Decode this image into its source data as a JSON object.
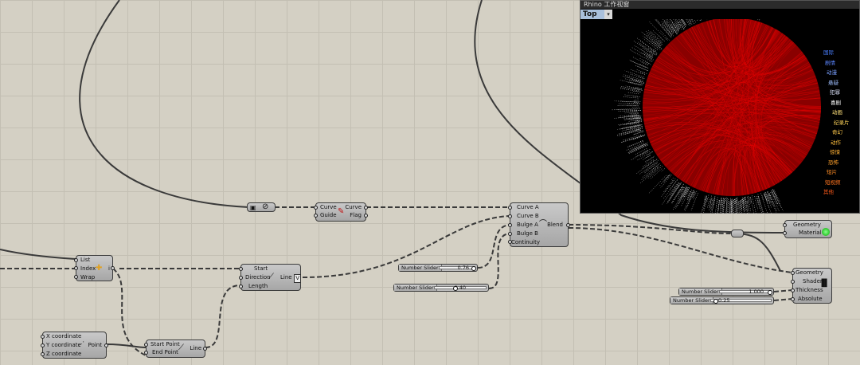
{
  "viewport": {
    "title": "Rhino 工作视窗",
    "view_name": "Top",
    "labels": [
      {
        "text": "国际",
        "color": "#4a7fff"
      },
      {
        "text": "剧情",
        "color": "#5b86ff"
      },
      {
        "text": "动漫",
        "color": "#7aa0ff"
      },
      {
        "text": "悬疑",
        "color": "#a0bfff"
      },
      {
        "text": "犯罪",
        "color": "#dfe6ff"
      },
      {
        "text": "喜剧",
        "color": "#ffffff"
      },
      {
        "text": "动画",
        "color": "#ffe07a"
      },
      {
        "text": "纪录片",
        "color": "#ffd55a"
      },
      {
        "text": "奇幻",
        "color": "#ffc94a"
      },
      {
        "text": "动作",
        "color": "#ffbf3d"
      },
      {
        "text": "惊悚",
        "color": "#ffb033"
      },
      {
        "text": "恐怖",
        "color": "#ffa02b"
      },
      {
        "text": "短片",
        "color": "#ff8c24"
      },
      {
        "text": "短视频",
        "color": "#ff741f"
      },
      {
        "text": "其他",
        "color": "#ff5a1a"
      }
    ]
  },
  "components": {
    "list_item": {
      "inputs": [
        "List",
        "Index",
        "Wrap"
      ],
      "output": "i"
    },
    "curve": {
      "inputs": [
        "Curve",
        "Guide"
      ],
      "outputs": [
        "Curve",
        "Flag"
      ]
    },
    "line_sdl": {
      "inputs": [
        "Start",
        "Direction",
        "Length"
      ],
      "output": "Line",
      "badge": "V"
    },
    "point": {
      "inputs": [
        "X coordinate",
        "Y coordinate",
        "Z coordinate"
      ],
      "output": "Point"
    },
    "line_two": {
      "inputs": [
        "Start Point",
        "End Point"
      ],
      "output": "Line"
    },
    "blend": {
      "inputs": [
        "Curve A",
        "Curve B",
        "Bulge A",
        "Bulge B",
        "Continuity"
      ],
      "output": "Blend"
    },
    "preview": {
      "inputs": [
        "Geometry",
        "Material"
      ]
    },
    "pipe": {
      "inputs": [
        "Geometry",
        "Shader",
        "Thickness",
        "Absolute"
      ]
    }
  },
  "sliders": [
    {
      "name": "Number Slider",
      "value": "0.76",
      "fraction": 0.93
    },
    {
      "name": "Number Slider",
      "value": "0.40",
      "fraction": 0.4
    },
    {
      "name": "Number Slider",
      "value": "1.000",
      "fraction": 1.0
    },
    {
      "name": "Number Slider",
      "value": "0.25",
      "fraction": 0.05
    }
  ],
  "colors": {
    "canvas": "#d4d0c4",
    "wire": "#3a3a3a",
    "viewport_bg": "#000000",
    "lines_red": "#cc0000"
  }
}
